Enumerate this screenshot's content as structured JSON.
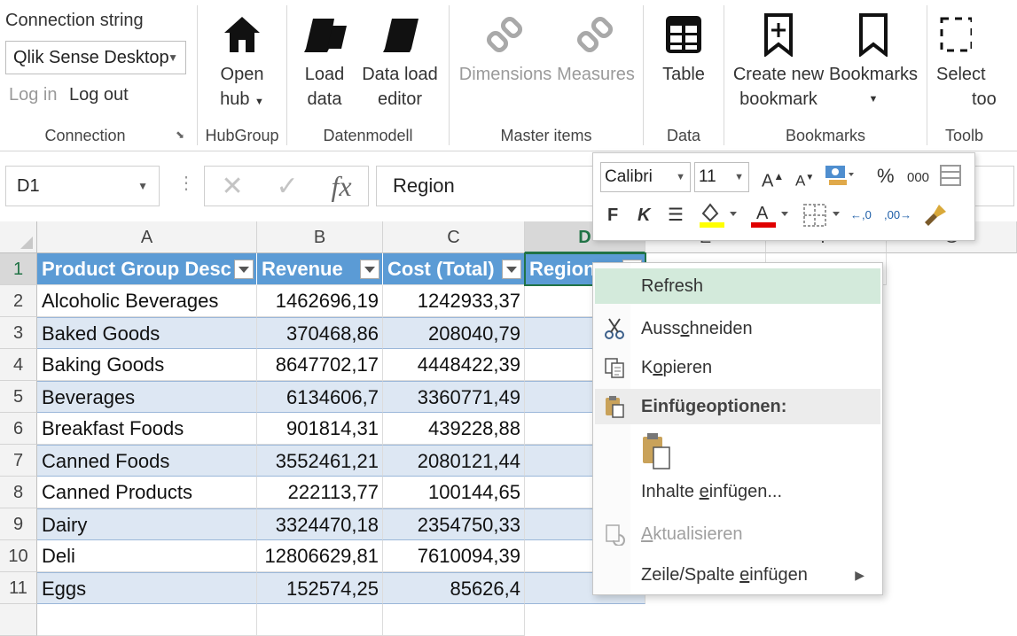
{
  "ribbon": {
    "connection": {
      "title": "Connection string",
      "selected": "Qlik Sense Desktop",
      "login": "Log in",
      "logout": "Log out",
      "group_label": "Connection"
    },
    "hubgroup": {
      "open_line1": "Open",
      "open_line2": "hub",
      "group_label": "HubGroup"
    },
    "datenmodell": {
      "load_line1": "Load",
      "load_line2": "data",
      "editor_line1": "Data load",
      "editor_line2": "editor",
      "group_label": "Datenmodell"
    },
    "master_items": {
      "dimensions": "Dimensions",
      "measures": "Measures",
      "group_label": "Master items"
    },
    "data": {
      "table": "Table",
      "group_label": "Data"
    },
    "bookmarks": {
      "create_line1": "Create new",
      "create_line2": "bookmark",
      "bookmarks": "Bookmarks",
      "group_label": "Bookmarks"
    },
    "toolbox": {
      "select_line1": "Select",
      "select_line2": "too",
      "group_label": "Toolb"
    }
  },
  "formula_bar": {
    "name_box": "D1",
    "value": "Region",
    "fx": "fx"
  },
  "grid": {
    "columns": [
      "A",
      "B",
      "C",
      "D",
      "E",
      "F",
      "G"
    ],
    "header_row": {
      "num": "1",
      "cells": [
        "Product Group Desc",
        "Revenue",
        "Cost (Total)",
        "Region"
      ]
    },
    "rows": [
      {
        "num": "2",
        "a": "Alcoholic Beverages",
        "b": "1462696,19",
        "c": "1242933,37"
      },
      {
        "num": "3",
        "a": "Baked Goods",
        "b": "370468,86",
        "c": "208040,79"
      },
      {
        "num": "4",
        "a": "Baking Goods",
        "b": "8647702,17",
        "c": "4448422,39"
      },
      {
        "num": "5",
        "a": "Beverages",
        "b": "6134606,7",
        "c": "3360771,49"
      },
      {
        "num": "6",
        "a": "Breakfast Foods",
        "b": "901814,31",
        "c": "439228,88"
      },
      {
        "num": "7",
        "a": "Canned Foods",
        "b": "3552461,21",
        "c": "2080121,44"
      },
      {
        "num": "8",
        "a": "Canned Products",
        "b": "222113,77",
        "c": "100144,65"
      },
      {
        "num": "9",
        "a": "Dairy",
        "b": "3324470,18",
        "c": "2354750,33"
      },
      {
        "num": "10",
        "a": "Deli",
        "b": "12806629,81",
        "c": "7610094,39"
      },
      {
        "num": "11",
        "a": "Eggs",
        "b": "152574,25",
        "c": "85626,4"
      }
    ]
  },
  "mini_toolbar": {
    "font": "Calibri",
    "size": "11",
    "bold": "F",
    "italic": "K",
    "percent": "%",
    "thousands": "000",
    "increase_font": "A",
    "decrease_font": "A"
  },
  "context_menu": {
    "refresh": "Refresh",
    "cut_pre": "Auss",
    "cut_u": "c",
    "cut_post": "hneiden",
    "copy_pre": "K",
    "copy_u": "o",
    "copy_post": "pieren",
    "paste_options": "Einfügeoptionen:",
    "paste_special_pre": "Inhalte ",
    "paste_special_u": "e",
    "paste_special_post": "infügen...",
    "update_pre": "",
    "update_u": "A",
    "update_post": "ktualisieren",
    "insert_pre": "Zeile/Spalte ",
    "insert_u": "e",
    "insert_post": "infügen"
  },
  "colors": {
    "table_header": "#5b9bd5",
    "band": "#dde7f3",
    "excel_green": "#217346",
    "menu_highlight": "#d3eadb"
  }
}
